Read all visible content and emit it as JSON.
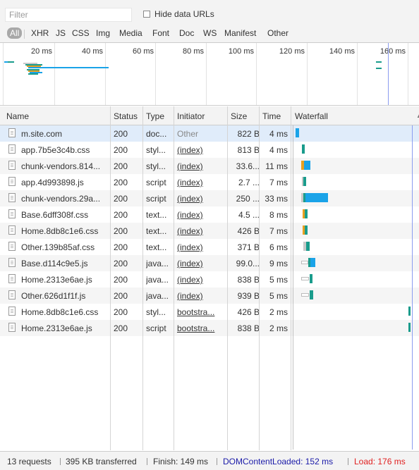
{
  "filter": {
    "placeholder": "Filter",
    "hide_data_urls_label": "Hide data URLs"
  },
  "type_filters": [
    "All",
    "XHR",
    "JS",
    "CSS",
    "Img",
    "Media",
    "Font",
    "Doc",
    "WS",
    "Manifest",
    "Other"
  ],
  "overview": {
    "ticks": [
      "20 ms",
      "40 ms",
      "60 ms",
      "80 ms",
      "100 ms",
      "120 ms",
      "140 ms",
      "160 ms"
    ]
  },
  "columns": {
    "name": "Name",
    "status": "Status",
    "type": "Type",
    "initiator": "Initiator",
    "size": "Size",
    "time": "Time",
    "waterfall": "Waterfall"
  },
  "requests": [
    {
      "name": "m.site.com",
      "status": "200",
      "type": "doc...",
      "initiator": "Other",
      "size": "822 B",
      "time": "4 ms"
    },
    {
      "name": "app.7b5e3c4b.css",
      "status": "200",
      "type": "styl...",
      "initiator": "(index)",
      "size": "813 B",
      "time": "4 ms"
    },
    {
      "name": "chunk-vendors.814...",
      "status": "200",
      "type": "styl...",
      "initiator": "(index)",
      "size": "33.6...",
      "time": "11 ms"
    },
    {
      "name": "app.4d993898.js",
      "status": "200",
      "type": "script",
      "initiator": "(index)",
      "size": "2.7 ...",
      "time": "7 ms"
    },
    {
      "name": "chunk-vendors.29a...",
      "status": "200",
      "type": "script",
      "initiator": "(index)",
      "size": "250 ...",
      "time": "33 ms"
    },
    {
      "name": "Base.6dff308f.css",
      "status": "200",
      "type": "text...",
      "initiator": "(index)",
      "size": "4.5 ...",
      "time": "8 ms"
    },
    {
      "name": "Home.8db8c1e6.css",
      "status": "200",
      "type": "text...",
      "initiator": "(index)",
      "size": "426 B",
      "time": "7 ms"
    },
    {
      "name": "Other.139b85af.css",
      "status": "200",
      "type": "text...",
      "initiator": "(index)",
      "size": "371 B",
      "time": "6 ms"
    },
    {
      "name": "Base.d114c9e5.js",
      "status": "200",
      "type": "java...",
      "initiator": "(index)",
      "size": "99.0...",
      "time": "9 ms"
    },
    {
      "name": "Home.2313e6ae.js",
      "status": "200",
      "type": "java...",
      "initiator": "(index)",
      "size": "838 B",
      "time": "5 ms"
    },
    {
      "name": "Other.626d1f1f.js",
      "status": "200",
      "type": "java...",
      "initiator": "(index)",
      "size": "939 B",
      "time": "5 ms"
    },
    {
      "name": "Home.8db8c1e6.css",
      "status": "200",
      "type": "styl...",
      "initiator": "bootstra...",
      "size": "426 B",
      "time": "2 ms"
    },
    {
      "name": "Home.2313e6ae.js",
      "status": "200",
      "type": "script",
      "initiator": "bootstra...",
      "size": "838 B",
      "time": "2 ms"
    }
  ],
  "footer": {
    "requests": "13 requests",
    "transferred": "395 KB transferred",
    "finish": "Finish: 149 ms",
    "dom_content_loaded": "DOMContentLoaded: 152 ms",
    "load": "Load: 176 ms"
  },
  "colors": {
    "waiting": "#1a9c8c",
    "download": "#1aa3e8",
    "queue": "#c8c8c8",
    "dcl": "#1a1aa8",
    "load": "#e02020",
    "selected_row": "#e0ecfa"
  }
}
